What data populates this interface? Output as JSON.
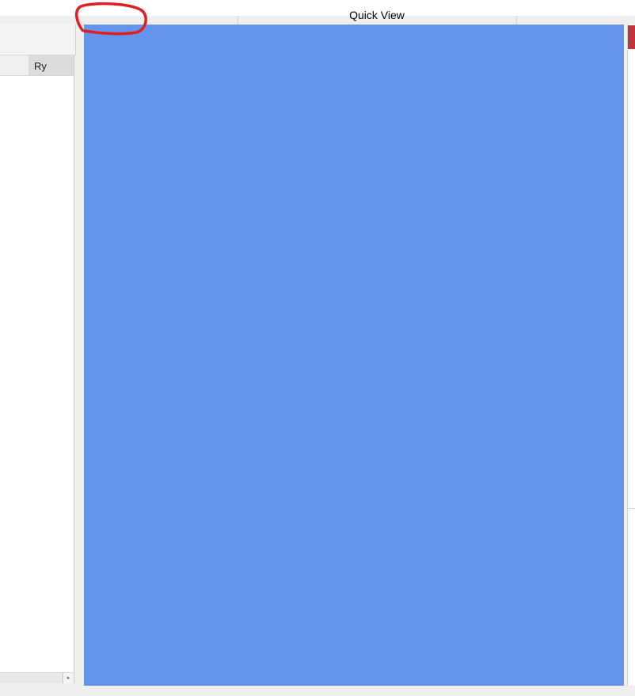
{
  "tabs": {
    "quick_view_label": "Quick View"
  },
  "left_table": {
    "columns": [
      "",
      "Ry"
    ]
  },
  "colors": {
    "preview_background": "#6495eb",
    "annotation_stroke": "#e02020",
    "right_marker": "#c0343b"
  },
  "icons": {
    "scroll_right": "▸"
  }
}
